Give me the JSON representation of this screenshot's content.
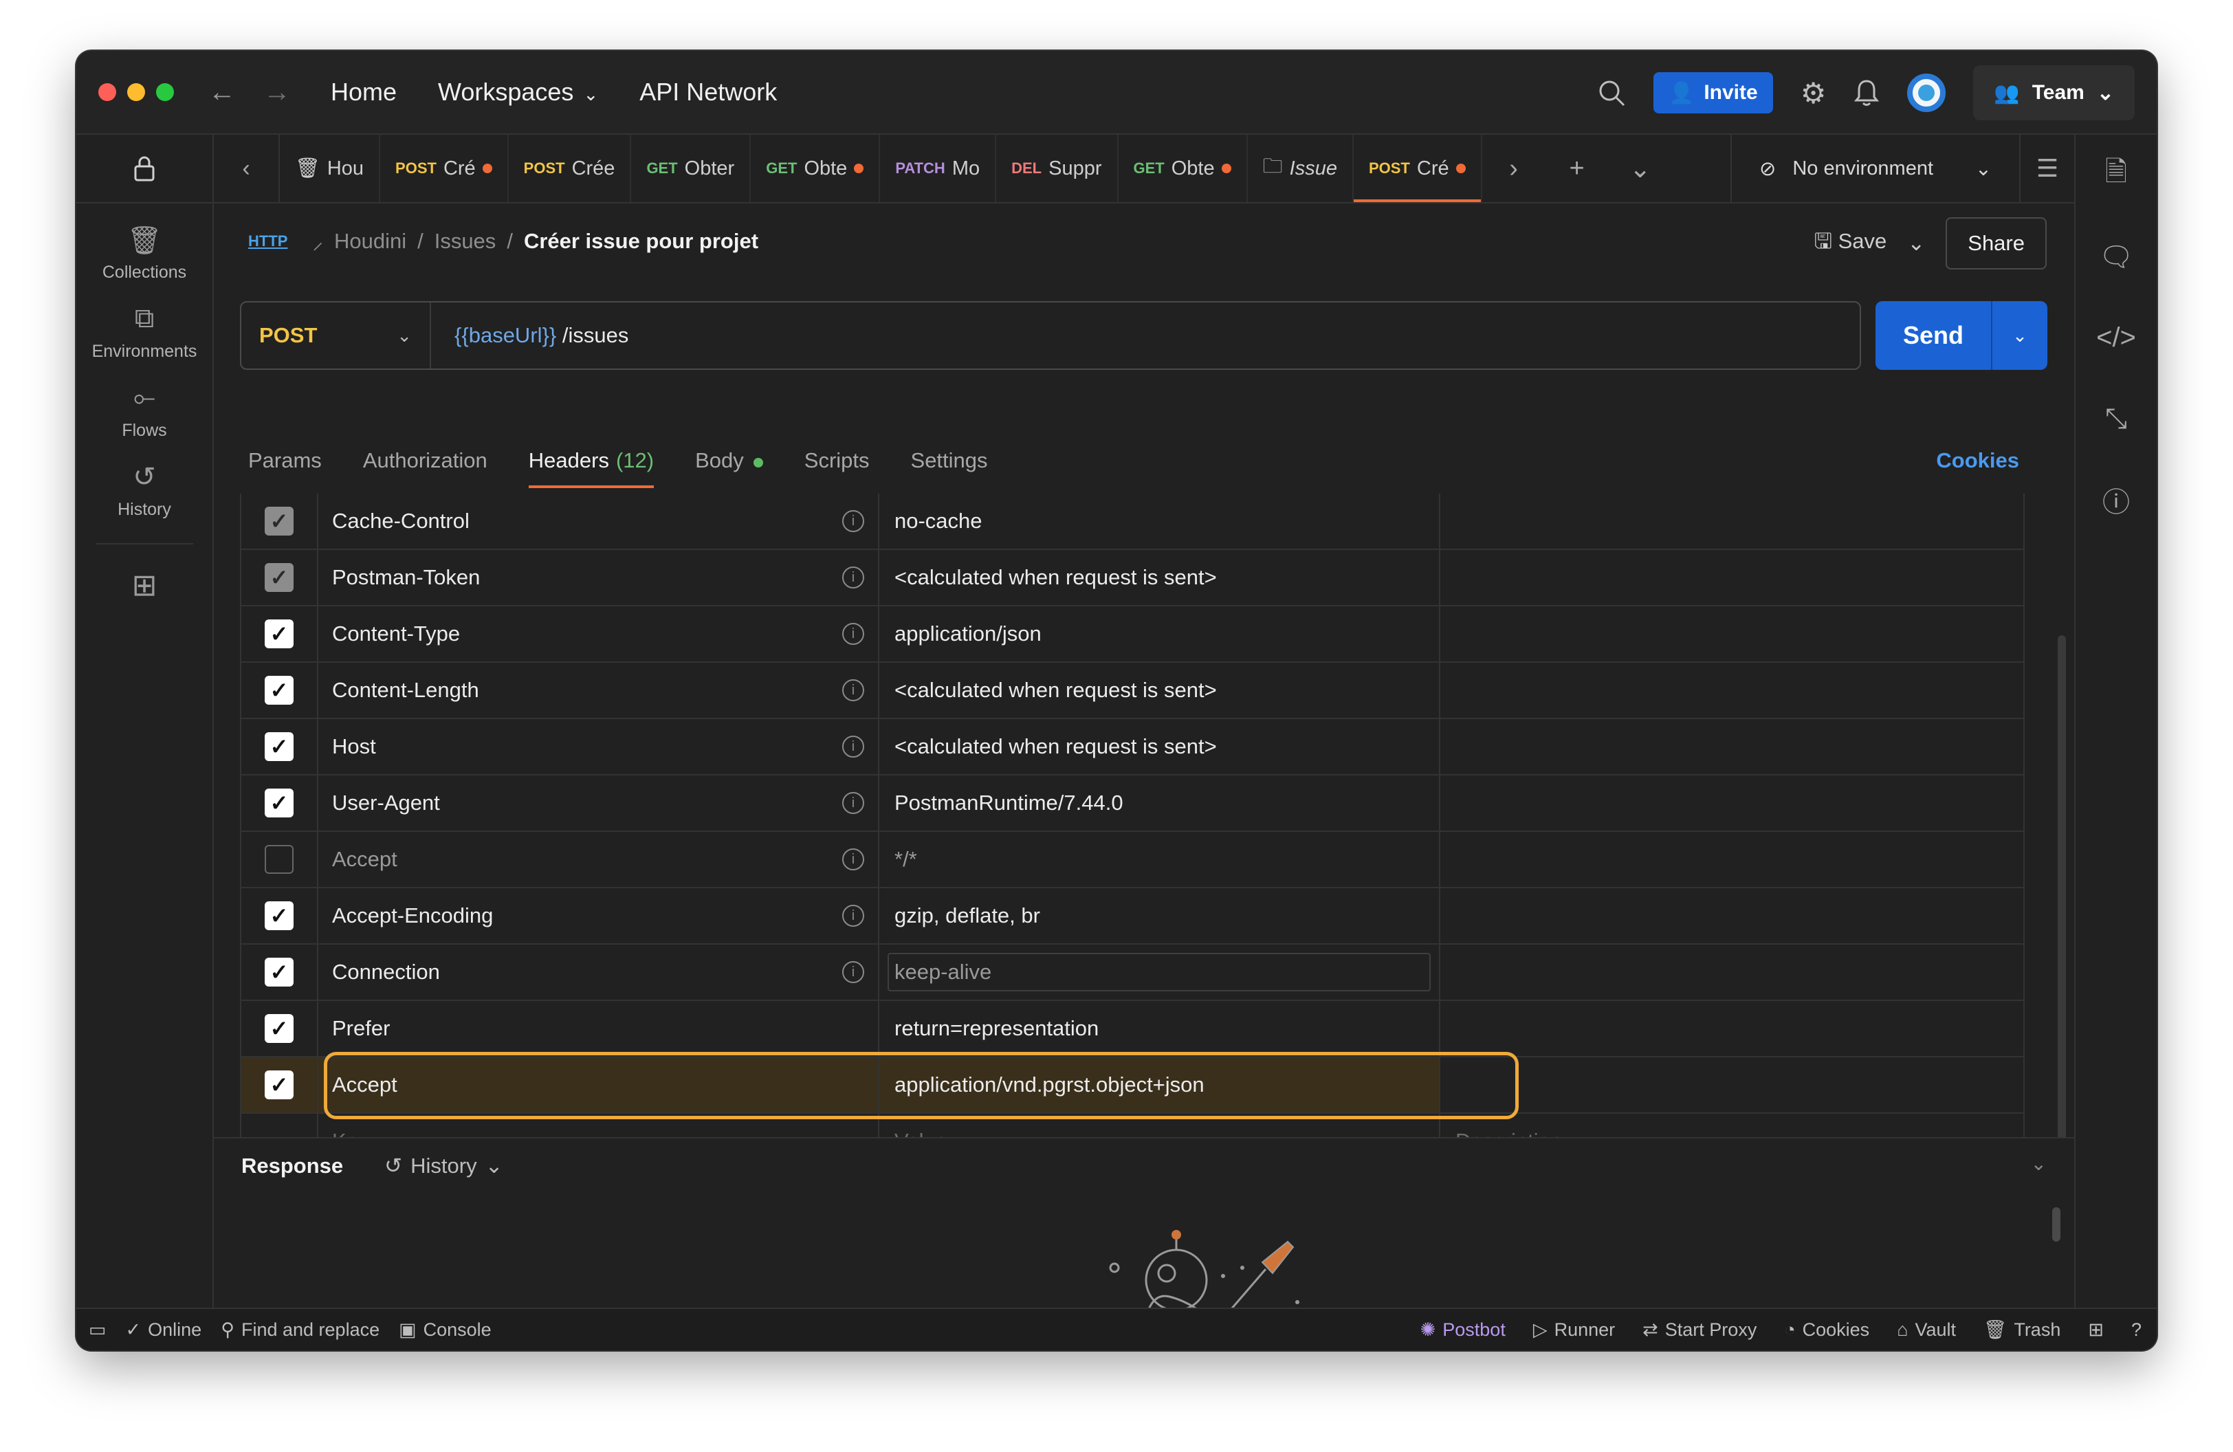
{
  "titlebar": {
    "nav": [
      "Home",
      "Workspaces",
      "API Network"
    ],
    "invite_label": "Invite",
    "team_label": "Team"
  },
  "sidebar": {
    "items": [
      {
        "label": "Collections",
        "icon": "collections-icon"
      },
      {
        "label": "Environments",
        "icon": "environments-icon"
      },
      {
        "label": "Flows",
        "icon": "flows-icon"
      },
      {
        "label": "History",
        "icon": "history-icon"
      }
    ]
  },
  "tabs": [
    {
      "method": "",
      "title": "Hou",
      "dot": false,
      "kind": "collection"
    },
    {
      "method": "POST",
      "title": "Cré",
      "dot": true
    },
    {
      "method": "POST",
      "title": "Crée",
      "dot": false
    },
    {
      "method": "GET",
      "title": "Obter",
      "dot": false
    },
    {
      "method": "GET",
      "title": "Obte",
      "dot": true
    },
    {
      "method": "PATCH",
      "title": "Mo",
      "dot": false
    },
    {
      "method": "DEL",
      "title": "Suppr",
      "dot": false
    },
    {
      "method": "GET",
      "title": "Obte",
      "dot": true
    },
    {
      "method": "",
      "title": "Issue",
      "dot": false,
      "kind": "folder"
    },
    {
      "method": "POST",
      "title": "Cré",
      "dot": true,
      "active": true
    }
  ],
  "environment": {
    "label": "No environment"
  },
  "breadcrumb": {
    "badge": "HTTP",
    "collection": "Houdini",
    "folder": "Issues",
    "request": "Créer issue pour projet"
  },
  "request_actions": {
    "save_label": "Save",
    "share_label": "Share"
  },
  "urlbar": {
    "method": "POST",
    "url_variable": "{{baseUrl}}",
    "url_path": " /issues",
    "send_label": "Send"
  },
  "subtabs": {
    "params": "Params",
    "authorization": "Authorization",
    "headers": "Headers",
    "headers_count": "(12)",
    "body": "Body",
    "scripts": "Scripts",
    "settings": "Settings",
    "cookies": "Cookies"
  },
  "headers": [
    {
      "key": "Cache-Control",
      "value": "no-cache",
      "state": "disabled",
      "info": true
    },
    {
      "key": "Postman-Token",
      "value": "<calculated when request is sent>",
      "state": "disabled",
      "info": true
    },
    {
      "key": "Content-Type",
      "value": "application/json",
      "state": "on",
      "info": true
    },
    {
      "key": "Content-Length",
      "value": "<calculated when request is sent>",
      "state": "on",
      "info": true
    },
    {
      "key": "Host",
      "value": "<calculated when request is sent>",
      "state": "on",
      "info": true
    },
    {
      "key": "User-Agent",
      "value": "PostmanRuntime/7.44.0",
      "state": "on",
      "info": true
    },
    {
      "key": "Accept",
      "value": "*/*",
      "state": "off",
      "info": true
    },
    {
      "key": "Accept-Encoding",
      "value": "gzip, deflate, br",
      "state": "on",
      "info": true
    },
    {
      "key": "Connection",
      "value": "keep-alive",
      "state": "on",
      "info": true,
      "editing": true
    },
    {
      "key": "Prefer",
      "value": "return=representation",
      "state": "on",
      "info": false
    },
    {
      "key": "Accept",
      "value": "application/vnd.pgrst.object+json",
      "state": "on",
      "info": false,
      "highlight": true
    }
  ],
  "new_row": {
    "key": "Key",
    "value": "Value",
    "description": "Description"
  },
  "response": {
    "label": "Response",
    "history_label": "History"
  },
  "statusbar": {
    "online": "Online",
    "find_replace": "Find and replace",
    "console": "Console",
    "postbot": "Postbot",
    "runner": "Runner",
    "start_proxy": "Start Proxy",
    "cookies": "Cookies",
    "vault": "Vault",
    "trash": "Trash"
  },
  "colors": {
    "accent_orange": "#f06a35",
    "send_blue": "#1b63d4",
    "highlight_border": "#f0a93a",
    "post": "#f3c546",
    "get": "#6bbf74"
  }
}
